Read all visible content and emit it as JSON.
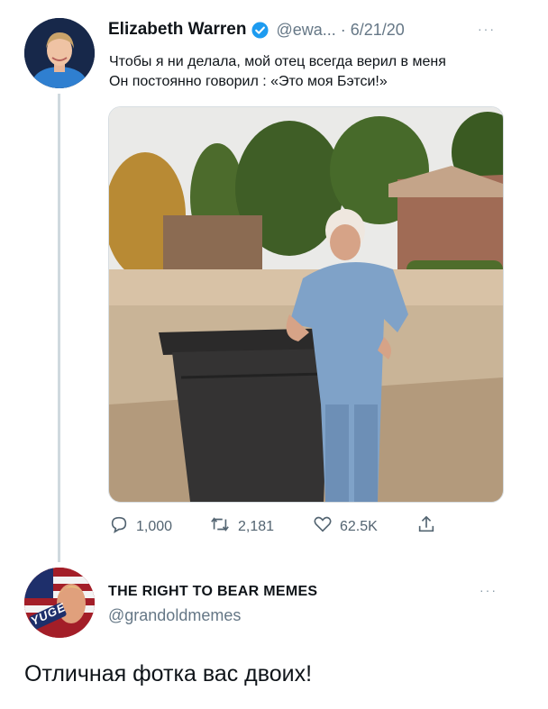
{
  "tweet": {
    "author_name": "Elizabeth Warren",
    "handle_date": "@ewa... · 6/21/20",
    "more": "···",
    "line1": "Чтобы я ни делала, мой отец всегда верил в меня",
    "line2": "Он постоянно говорил : «Это моя Бэтси!»",
    "actions": {
      "replies": "1,000",
      "retweets": "2,181",
      "likes": "62.5K"
    }
  },
  "reply": {
    "author_name": "THE RIGHT TO BEAR MEMES",
    "handle": "@grandoldmemes",
    "more": "···",
    "avatar_text": "YUGE",
    "text": "Отличная фотка вас двоих!"
  },
  "colors": {
    "verified": "#1d9bf0",
    "muted": "#657786"
  },
  "icons": [
    "verified-badge-icon",
    "reply-icon",
    "retweet-icon",
    "like-icon",
    "share-icon"
  ]
}
